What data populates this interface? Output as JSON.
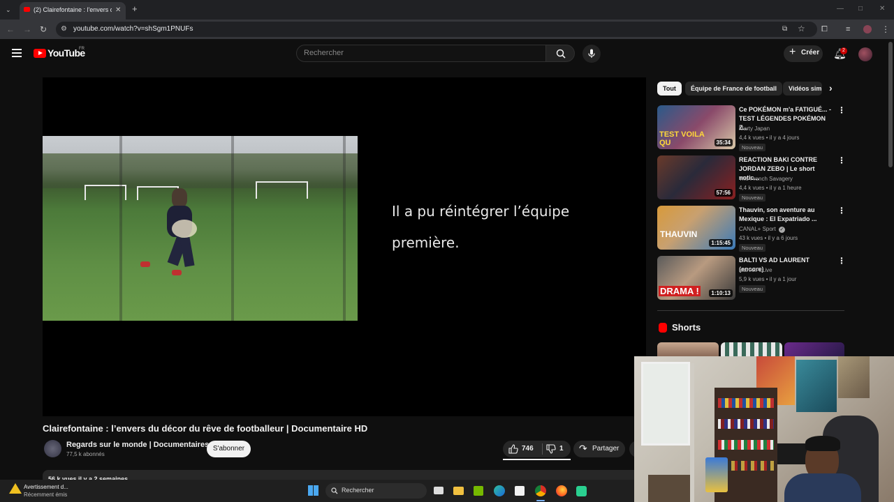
{
  "browser": {
    "tab_title": "(2) Clairefontaine : l'envers du d",
    "url": "youtube.com/watch?v=shSgm1PNUFs"
  },
  "header": {
    "logo_text": "YouTube",
    "logo_country": "FR",
    "search_placeholder": "Rechercher",
    "create_label": "Créer",
    "notification_count": "2"
  },
  "video": {
    "caption_line1": "Il a pu réintégrer l’équipe",
    "caption_line2": "première.",
    "title": "Clairefontaine : l’envers du décor du rêve de footballeur | Documentaire HD",
    "channel_name": "Regards sur le monde | Documentaires",
    "channel_subs": "77,5 k abonnés",
    "subscribe_label": "S'abonner",
    "likes": "746",
    "dislikes": "1",
    "share_label": "Partager",
    "description_peek": "56 k vues  il y a 2 semaines"
  },
  "sidebar": {
    "chips": [
      {
        "label": "Tout",
        "active": true
      },
      {
        "label": "Équipe de France de football",
        "active": false
      },
      {
        "label": "Vidéos sim",
        "active": false
      }
    ],
    "recommendations": [
      {
        "title": "Ce POKÉMON m'a FATIGUÉ... - TEST LÉGENDES POKÉMON Z...",
        "channel": "Marty Japan",
        "meta": "4,4 k vues • il y a 4 jours",
        "badge": "Nouveau",
        "duration": "35:34",
        "thumb_text": "TEST VOILA QU",
        "verified": false
      },
      {
        "title": "REACTION BAKI CONTRE JORDAN ZEBO | Le short notic...",
        "channel": "The French Savagery",
        "meta": "4,4 k vues • il y a 1 heure",
        "badge": "Nouveau",
        "duration": "57:56",
        "thumb_text": "",
        "verified": false
      },
      {
        "title": "Thauvin, son aventure au Mexique : El Expatriado ...",
        "channel": "CANAL+ Sport",
        "meta": "43 k vues • il y a 6 jours",
        "badge": "Nouveau",
        "duration": "1:15:45",
        "thumb_text": "THAUVIN",
        "verified": true
      },
      {
        "title": "BALTI VS AD LAURENT (encore)",
        "channel": "MarvelFitLive",
        "meta": "5,9 k vues • il y a 1 jour",
        "badge": "Nouveau",
        "duration": "1:10:13",
        "thumb_text": "DRAMA !",
        "verified": false
      }
    ],
    "shorts_title": "Shorts"
  },
  "taskbar": {
    "notification_title": "Avertissement d...",
    "notification_subtitle": "Récemment émis",
    "search_label": "Rechercher"
  },
  "colors": {
    "background": "#0f0f0f",
    "youtube_red": "#ff0000",
    "chip_active_bg": "#f1f1f1",
    "chip_bg": "#272727"
  }
}
